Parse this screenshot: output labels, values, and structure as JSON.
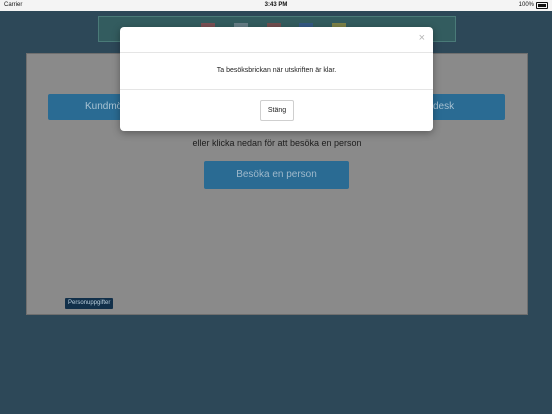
{
  "status_bar": {
    "carrier": "Carrier",
    "time": "3:43 PM",
    "battery_percent": "100%"
  },
  "flags": {
    "colors": [
      "#c4444a",
      "#9aa0b0",
      "#b04040",
      "#3355aa",
      "#c8a830"
    ]
  },
  "main": {
    "customer_button_label": "Kundmö",
    "helpdesk_button_label": "desk",
    "or_text": "eller klicka nedan för att besöka en person",
    "visit_button_label": "Besöka en person",
    "personal_info_button_label": "Personuppgifter"
  },
  "modal": {
    "close_symbol": "×",
    "message": "Ta besöksbrickan när utskriften är klar.",
    "close_button_label": "Stäng"
  }
}
